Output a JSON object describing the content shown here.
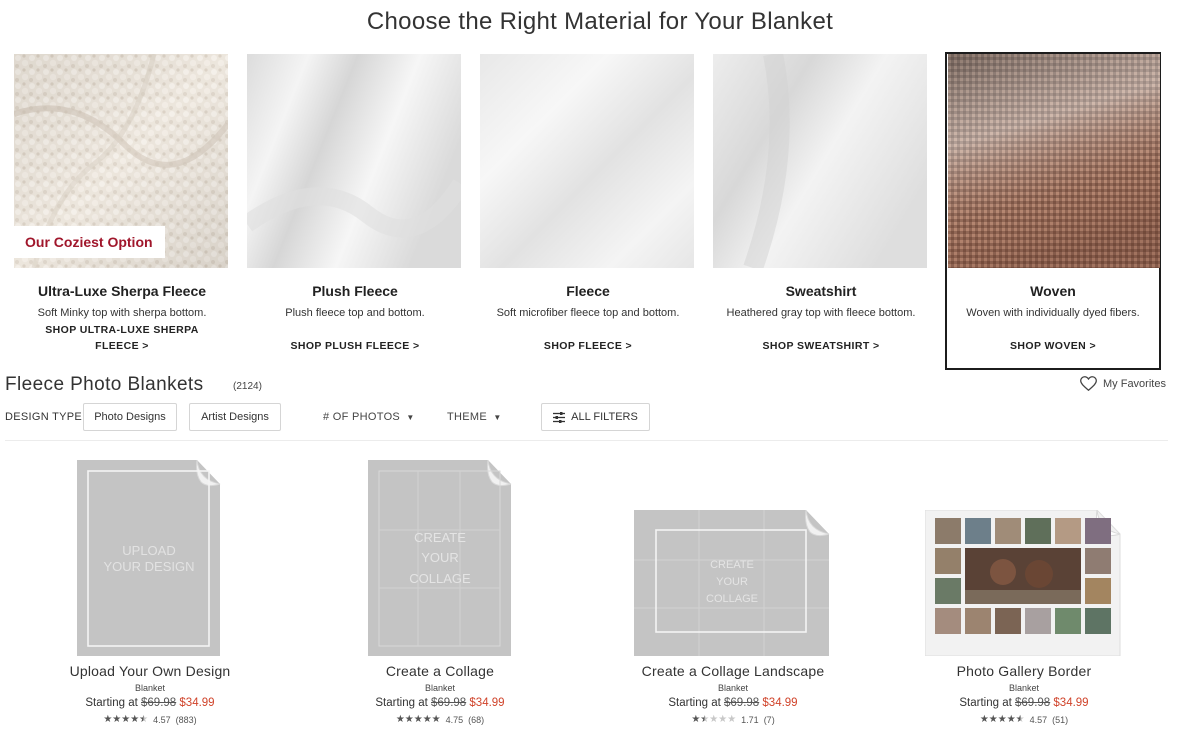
{
  "page_title": "Choose the Right Material for Your Blanket",
  "materials": [
    {
      "name": "Ultra-Luxe Sherpa Fleece",
      "desc": "Soft Minky top with sherpa bottom.",
      "link": "SHOP ULTRA-LUXE SHERPA FLEECE >",
      "badge": "Our Coziest Option"
    },
    {
      "name": "Plush Fleece",
      "desc": "Plush fleece top and bottom.",
      "link": "SHOP PLUSH FLEECE >"
    },
    {
      "name": "Fleece",
      "desc": "Soft microfiber fleece top and bottom.",
      "link": "SHOP FLEECE >"
    },
    {
      "name": "Sweatshirt",
      "desc": "Heathered gray top with fleece bottom.",
      "link": "SHOP SWEATSHIRT >"
    },
    {
      "name": "Woven",
      "desc": "Woven with individually dyed fibers.",
      "link": "SHOP WOVEN >"
    }
  ],
  "section": {
    "title": "Fleece Photo Blankets",
    "count": "(2124)",
    "favorites": "My Favorites"
  },
  "filters": {
    "design_type_label": "DESIGN TYPE",
    "photo_designs": "Photo Designs",
    "artist_designs": "Artist Designs",
    "num_photos": "# OF PHOTOS",
    "theme": "THEME",
    "all_filters": "ALL FILTERS"
  },
  "products": [
    {
      "name": "Upload Your Own Design",
      "type": "Blanket",
      "starting": "Starting at",
      "old_price": "$69.98",
      "price": "$34.99",
      "rating": 4.57,
      "rating_text": "4.57",
      "reviews": "(883)",
      "overlay": [
        "UPLOAD",
        "YOUR DESIGN"
      ]
    },
    {
      "name": "Create a Collage",
      "type": "Blanket",
      "starting": "Starting at",
      "old_price": "$69.98",
      "price": "$34.99",
      "rating": 4.75,
      "rating_text": "4.75",
      "reviews": "(68)",
      "overlay": [
        "CREATE",
        "YOUR",
        "COLLAGE"
      ]
    },
    {
      "name": "Create a Collage Landscape",
      "type": "Blanket",
      "starting": "Starting at",
      "old_price": "$69.98",
      "price": "$34.99",
      "rating": 1.71,
      "rating_text": "1.71",
      "reviews": "(7)",
      "overlay": [
        "CREATE",
        "YOUR",
        "COLLAGE"
      ]
    },
    {
      "name": "Photo Gallery Border",
      "type": "Blanket",
      "starting": "Starting at",
      "old_price": "$69.98",
      "price": "$34.99",
      "rating": 4.57,
      "rating_text": "4.57",
      "reviews": "(51)"
    }
  ],
  "colors": {
    "badge": "#a0162b",
    "sale_price": "#d0432a",
    "blanket_gray": "#c4c4c4"
  }
}
